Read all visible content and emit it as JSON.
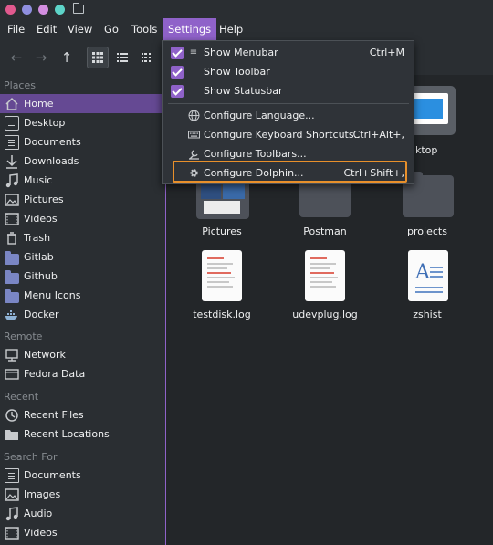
{
  "titlebar": {
    "dot_colors": [
      "#e1598e",
      "#8f8fdf",
      "#d38ee0",
      "#5dd4c8"
    ]
  },
  "menubar": {
    "items": [
      "File",
      "Edit",
      "View",
      "Go",
      "Tools",
      "Settings",
      "Help"
    ],
    "active": "Settings"
  },
  "toolbar": {
    "back_icon": "back-arrow-icon",
    "forward_icon": "forward-arrow-icon",
    "up_icon": "up-arrow-icon",
    "icons_view_icon": "icons-view-icon",
    "details_view_icon": "details-view-icon",
    "compact_view_icon": "compact-view-icon"
  },
  "sidebar": {
    "places_label": "Places",
    "places": [
      "Home",
      "Desktop",
      "Documents",
      "Downloads",
      "Music",
      "Pictures",
      "Videos",
      "Trash",
      "Gitlab",
      "Github",
      "Menu Icons",
      "Docker"
    ],
    "remote_label": "Remote",
    "remote": [
      "Network",
      "Fedora Data"
    ],
    "recent_label": "Recent",
    "recent": [
      "Recent Files",
      "Recent Locations"
    ],
    "search_label": "Search For",
    "search": [
      "Documents",
      "Images",
      "Audio",
      "Videos"
    ]
  },
  "main": {
    "row1_partial": [
      "ktop"
    ],
    "row2": [
      "Pictures",
      "Postman",
      "projects"
    ],
    "row3": [
      "testdisk.log",
      "udevplug.log",
      "zshist"
    ]
  },
  "settings_menu": {
    "items": [
      {
        "label": "Show Menubar",
        "shortcut": "Ctrl+M",
        "checked": true
      },
      {
        "label": "Show Toolbar",
        "shortcut": "",
        "checked": true
      },
      {
        "label": "Show Statusbar",
        "shortcut": "",
        "checked": true
      },
      {
        "label": "Configure Language...",
        "shortcut": "",
        "icon": "globe-icon"
      },
      {
        "label": "Configure Keyboard Shortcuts...",
        "shortcut": "Ctrl+Alt+,",
        "icon": "keyboard-icon"
      },
      {
        "label": "Configure Toolbars...",
        "shortcut": "",
        "icon": "toolbars-icon"
      },
      {
        "label": "Configure Dolphin...",
        "shortcut": "Ctrl+Shift+,",
        "icon": "gear-icon"
      }
    ],
    "highlighted": "Configure Dolphin...",
    "accent": "#8f62c9",
    "highlight_color": "#e8902b"
  }
}
